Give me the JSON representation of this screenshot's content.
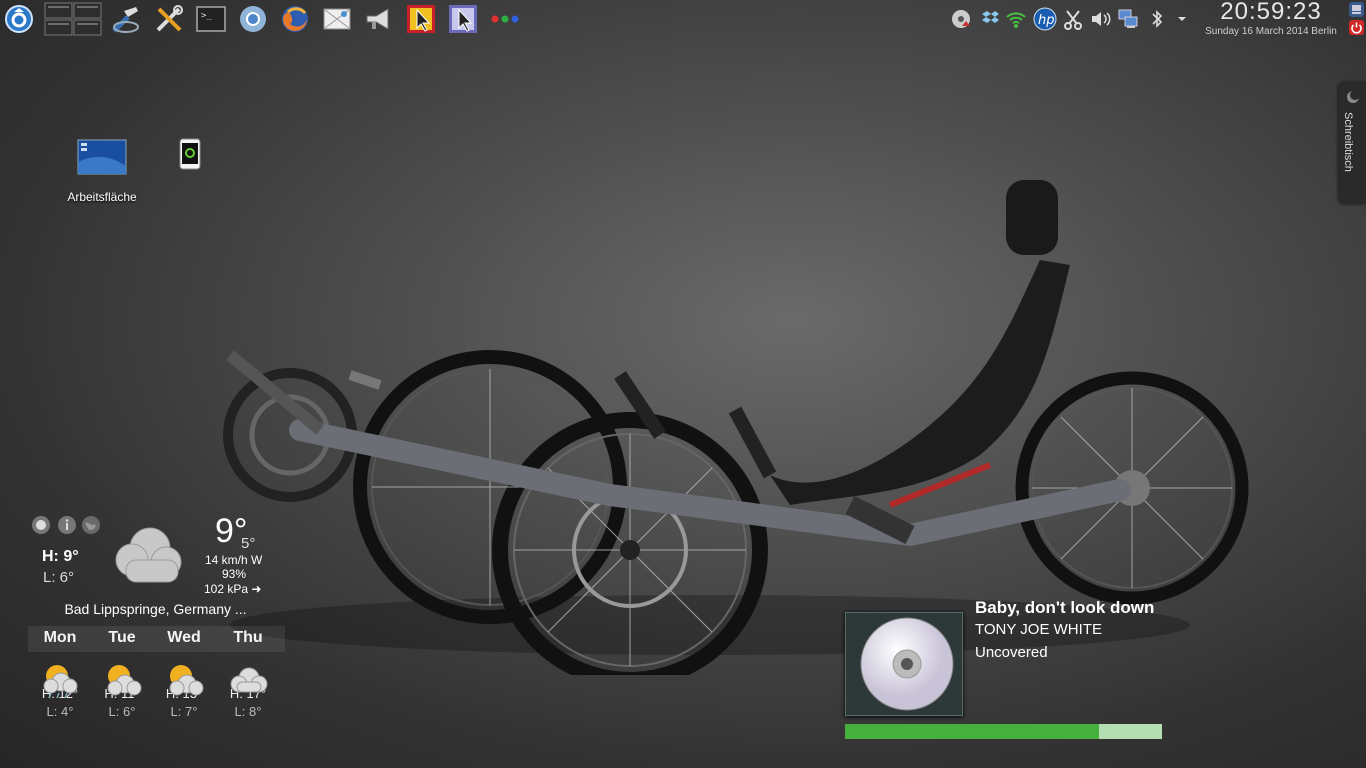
{
  "panel": {
    "launchers": [
      "kde-menu-icon",
      "pager-icon",
      "system-settings-icon",
      "tools-icon",
      "terminal-icon",
      "chromium-icon",
      "firefox-icon",
      "screenshot-icon",
      "megaphone-icon",
      "pointer-app-red-icon",
      "pointer-app-blue-icon",
      "dots-icon"
    ],
    "tray": [
      "network-disk-icon",
      "dropbox-icon",
      "wifi-icon",
      "hp-icon",
      "scissors-icon",
      "volume-icon",
      "network-icon",
      "bluetooth-icon",
      "tray-expand-icon"
    ]
  },
  "clock": {
    "time": "20:59:23",
    "date": "Sunday 16 March 2014 Berlin"
  },
  "desktop": {
    "icons": [
      {
        "label": "Arbeitsfläche",
        "icon": "desktop-folder-icon"
      },
      {
        "label": "",
        "icon": "phone-icon"
      }
    ]
  },
  "sidetab": {
    "label": "Schreibtisch"
  },
  "weather": {
    "current_hi": "H: 9°",
    "current_lo": "L: 6°",
    "temp": "9°",
    "feels": "5°",
    "wind": "14 km/h W",
    "humidity": "93%",
    "pressure": "102 kPa ➜",
    "location": "Bad Lippspringe, Germany ...",
    "forecast": [
      {
        "day": "Mon",
        "hi": "H: 12°",
        "lo": "L: 4°",
        "icon": "rain-sun-icon"
      },
      {
        "day": "Tue",
        "hi": "H: 11°",
        "lo": "L: 6°",
        "icon": "sun-cloud-icon"
      },
      {
        "day": "Wed",
        "hi": "H: 13°",
        "lo": "L: 7°",
        "icon": "sun-cloud-icon"
      },
      {
        "day": "Thu",
        "hi": "H: 17°",
        "lo": "L: 8°",
        "icon": "cloud-icon"
      }
    ]
  },
  "media": {
    "title": "Baby, don't look down",
    "artist": "TONY JOE WHITE",
    "album": "Uncovered",
    "progress_fraction": 0.8
  }
}
